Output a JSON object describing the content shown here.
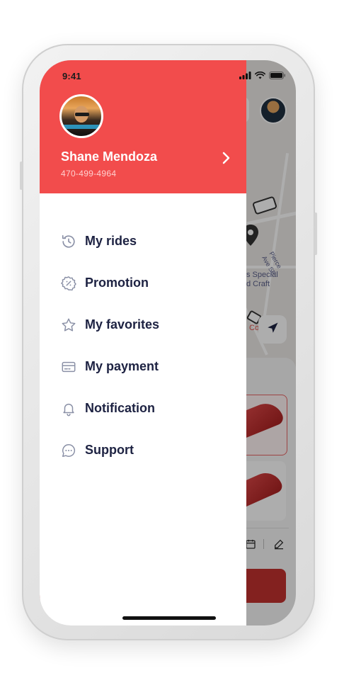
{
  "status_bar": {
    "time": "9:41"
  },
  "profile": {
    "name": "Shane Mendoza",
    "phone": "470-499-4964"
  },
  "menu": {
    "items": [
      {
        "label": "My rides",
        "icon": "history-icon"
      },
      {
        "label": "Promotion",
        "icon": "discount-badge-icon"
      },
      {
        "label": "My favorites",
        "icon": "star-icon"
      },
      {
        "label": "My payment",
        "icon": "credit-card-icon"
      },
      {
        "label": "Notification",
        "icon": "bell-icon"
      },
      {
        "label": "Support",
        "icon": "chat-bubble-icon"
      }
    ]
  },
  "map": {
    "labels": {
      "place_line1": "s Special",
      "place_line2": "d Craft",
      "street": "Pierce Ave SE",
      "poi": "Co By"
    }
  },
  "colors": {
    "header_red": "#f24c4c",
    "menu_text": "#1d2242",
    "icon_gray": "#8a90a6",
    "cta_red": "#c2312f"
  }
}
